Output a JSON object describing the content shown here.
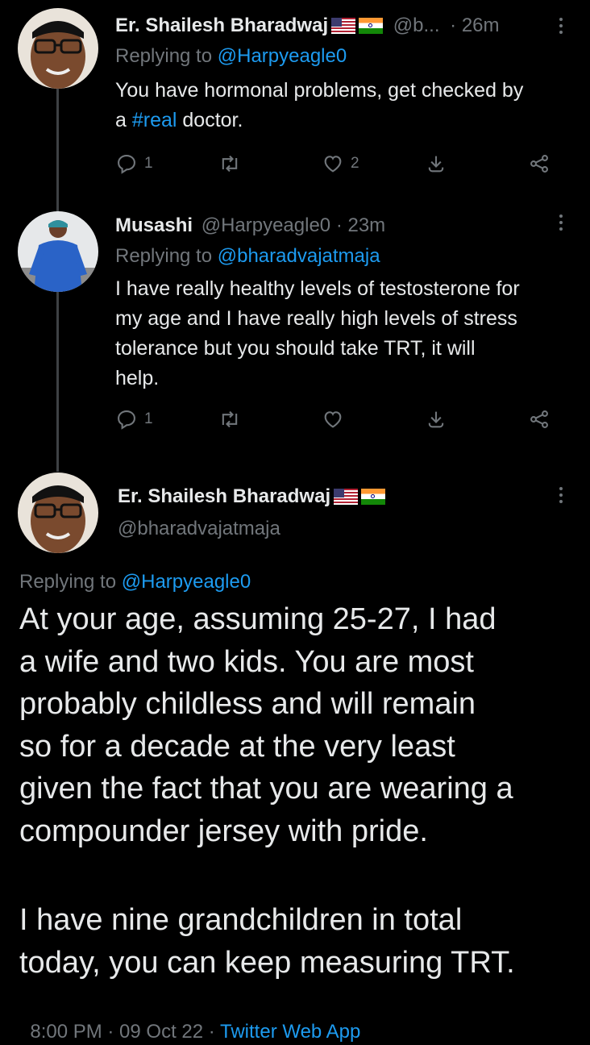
{
  "tweets": [
    {
      "author": "Er. Shailesh Bharadwaj",
      "handle": "@b...",
      "time": "· 26m",
      "replying_prefix": "Replying to",
      "replying_to": "@Harpyeagle0",
      "text_part1": "You have hormonal problems, get checked by",
      "text_part2_pre": "a ",
      "text_part2_tag": "#real",
      "text_part2_post": " doctor.",
      "reply_count": "1",
      "like_count": "2"
    },
    {
      "author": "Musashi",
      "handle_time": "@Harpyeagle0 · 23m",
      "replying_prefix": "Replying to",
      "replying_to": "@bharadvajatmaja",
      "lines": [
        "I have really healthy levels of testosterone for",
        "my age and I have really high levels of stress",
        "tolerance but you should take TRT, it will",
        "help."
      ],
      "reply_count": "1"
    }
  ],
  "focused": {
    "author": "Er. Shailesh Bharadwaj",
    "handle": "@bharadvajatmaja",
    "replying_prefix": "Replying to",
    "replying_to": "@Harpyeagle0",
    "paragraph1": [
      "At your age, assuming 25-27, I had",
      "a wife and two kids. You are most",
      "probably childless and will remain",
      "so for a decade at the very least",
      "given the fact that you are wearing a",
      "compounder jersey with pride."
    ],
    "paragraph2": [
      "I have nine grandchildren in total",
      "today, you can keep measuring TRT."
    ],
    "timestamp": "8:00 PM · 09 Oct 22 · ",
    "source": "Twitter Web App"
  },
  "flags": [
    "us-flag",
    "india-flag"
  ],
  "colors": {
    "background": "#000000",
    "text": "#e7e9ea",
    "secondary": "#71767b",
    "link": "#1d9bf0"
  },
  "icons": [
    "reply-icon",
    "retweet-icon",
    "like-icon",
    "share-icon",
    "more-icon"
  ]
}
